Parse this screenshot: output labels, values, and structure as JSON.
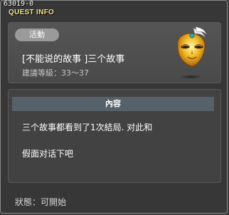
{
  "window": {
    "quest_id": "63019-0",
    "title": "QUEST INFO"
  },
  "quest": {
    "category_badge": "活動",
    "name": "[不能说的故事 ]三个故事",
    "level_range": "建議等級：33～37",
    "icon": "golden-mask-icon"
  },
  "content": {
    "header": "內容",
    "lines": [
      "三个故事都看到了1次結局. 对此和",
      "假面对话下吧"
    ]
  },
  "status": {
    "text": "狀態：可開始"
  },
  "colors": {
    "title": "#f1e58a",
    "content_header_bg": "#566169",
    "badge_bg": "#9a9a9a",
    "window_bg": "#373737"
  }
}
